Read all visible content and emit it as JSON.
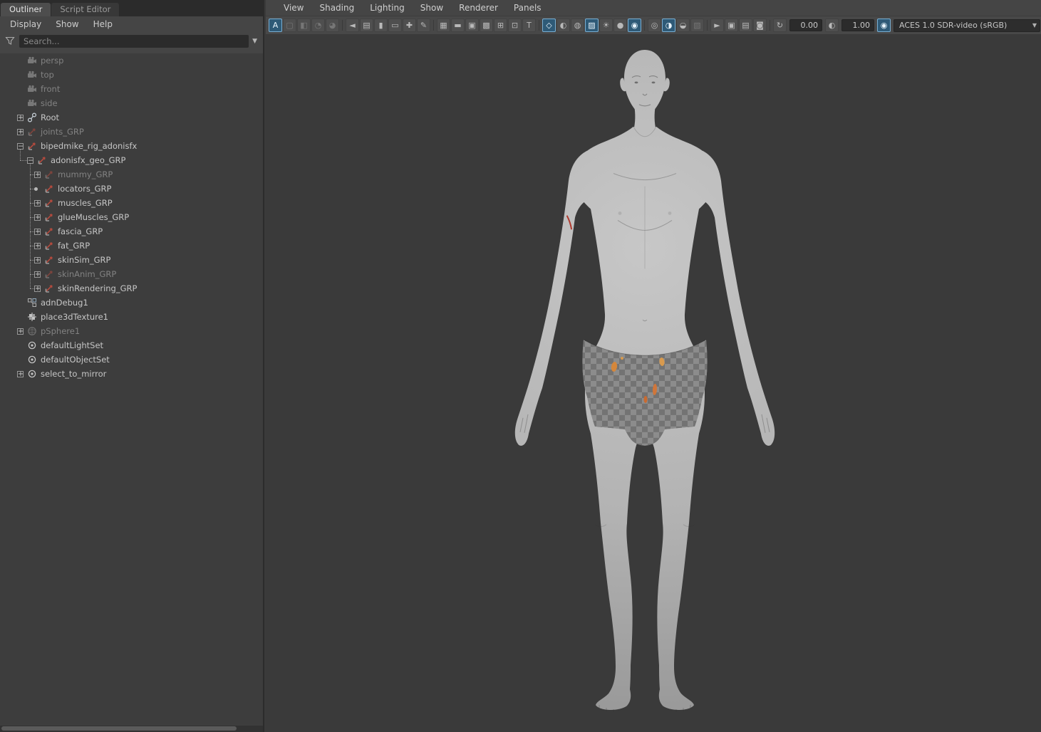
{
  "outliner": {
    "tabs": [
      {
        "label": "Outliner",
        "active": true
      },
      {
        "label": "Script Editor",
        "active": false
      }
    ],
    "menus": [
      {
        "label": "Display"
      },
      {
        "label": "Show"
      },
      {
        "label": "Help"
      }
    ],
    "search": {
      "placeholder": "Search..."
    },
    "tree": [
      {
        "label": "persp",
        "icon": "camera-icon",
        "dim": true,
        "indent": 1
      },
      {
        "label": "top",
        "icon": "camera-icon",
        "dim": true,
        "indent": 1
      },
      {
        "label": "front",
        "icon": "camera-icon",
        "dim": true,
        "indent": 1
      },
      {
        "label": "side",
        "icon": "camera-icon",
        "dim": true,
        "indent": 1
      },
      {
        "label": "Root",
        "icon": "joint-icon",
        "indent": 1,
        "expander": "plus"
      },
      {
        "label": "joints_GRP",
        "icon": "transform-icon",
        "dim": true,
        "indent": 1,
        "expander": "plus"
      },
      {
        "label": "bipedmike_rig_adonisfx",
        "icon": "transform-icon",
        "indent": 1,
        "expander": "minus"
      },
      {
        "label": "adonisfx_geo_GRP",
        "icon": "transform-icon",
        "indent": 2,
        "expander": "minus",
        "dash": true
      },
      {
        "label": "mummy_GRP",
        "icon": "transform-icon",
        "dim": true,
        "indent": 3,
        "expander": "plus",
        "dash": true
      },
      {
        "label": "locators_GRP",
        "icon": "transform-icon",
        "indent": 3,
        "expander": "dot",
        "dash": true
      },
      {
        "label": "muscles_GRP",
        "icon": "transform-icon",
        "indent": 3,
        "expander": "plus",
        "dash": true
      },
      {
        "label": "glueMuscles_GRP",
        "icon": "transform-icon",
        "indent": 3,
        "expander": "plus",
        "dash": true
      },
      {
        "label": "fascia_GRP",
        "icon": "transform-icon",
        "indent": 3,
        "expander": "plus",
        "dash": true
      },
      {
        "label": "fat_GRP",
        "icon": "transform-icon",
        "indent": 3,
        "expander": "plus",
        "dash": true
      },
      {
        "label": "skinSim_GRP",
        "icon": "transform-icon",
        "indent": 3,
        "expander": "plus",
        "dash": true
      },
      {
        "label": "skinAnim_GRP",
        "icon": "transform-icon",
        "dim": true,
        "indent": 3,
        "expander": "plus",
        "dash": true
      },
      {
        "label": "skinRendering_GRP",
        "icon": "transform-icon",
        "indent": 3,
        "expander": "plus",
        "dash": true
      },
      {
        "label": "adnDebug1",
        "icon": "adn-debug-icon",
        "indent": 1
      },
      {
        "label": "place3dTexture1",
        "icon": "place3d-texture-icon",
        "indent": 1
      },
      {
        "label": "pSphere1",
        "icon": "mesh-icon",
        "dim": true,
        "indent": 1,
        "expander": "plus"
      },
      {
        "label": "defaultLightSet",
        "icon": "set-icon",
        "indent": 1
      },
      {
        "label": "defaultObjectSet",
        "icon": "set-icon",
        "indent": 1
      },
      {
        "label": "select_to_mirror",
        "icon": "set-icon",
        "indent": 1,
        "expander": "plus"
      }
    ]
  },
  "viewport": {
    "menus": [
      {
        "label": "View"
      },
      {
        "label": "Shading"
      },
      {
        "label": "Lighting"
      },
      {
        "label": "Show"
      },
      {
        "label": "Renderer"
      },
      {
        "label": "Panels"
      }
    ],
    "toolbar": [
      {
        "name": "panel-focus-a-icon",
        "active": true
      },
      {
        "name": "wireframe-on-shaded-icon",
        "dim": true
      },
      {
        "name": "default-material-icon",
        "dim": true
      },
      {
        "name": "hardware-texture-icon",
        "dim": true
      },
      {
        "name": "hardware-light-icon",
        "dim": true
      },
      {
        "sep": true
      },
      {
        "name": "select-camera-icon"
      },
      {
        "name": "camera-attributes-icon"
      },
      {
        "name": "bookmark-icon"
      },
      {
        "name": "image-plane-icon"
      },
      {
        "name": "two-d-pan-zoom-icon"
      },
      {
        "name": "grease-pencil-icon"
      },
      {
        "sep": true
      },
      {
        "name": "grid-icon"
      },
      {
        "name": "film-gate-icon"
      },
      {
        "name": "resolution-gate-icon"
      },
      {
        "name": "gate-mask-icon"
      },
      {
        "name": "field-chart-icon"
      },
      {
        "name": "safe-action-icon"
      },
      {
        "name": "safe-title-icon"
      },
      {
        "sep": true
      },
      {
        "name": "shaded-cube-icon",
        "active": true
      },
      {
        "name": "smooth-shade-icon"
      },
      {
        "name": "wireframe-sphere-icon"
      },
      {
        "name": "textured-icon",
        "active": true
      },
      {
        "name": "use-all-lights-icon"
      },
      {
        "name": "shadows-icon"
      },
      {
        "name": "ssao-icon",
        "active": true
      },
      {
        "sep": true
      },
      {
        "name": "motion-blur-icon"
      },
      {
        "name": "multisample-icon",
        "active": true
      },
      {
        "name": "depth-of-field-icon"
      },
      {
        "name": "fog-icon",
        "dim": true
      },
      {
        "sep": true
      },
      {
        "name": "isolate-select-icon"
      },
      {
        "name": "copy-snapshot-icon"
      },
      {
        "name": "paste-snapshot-icon"
      },
      {
        "name": "snapshot-image-icon"
      },
      {
        "sep": true
      },
      {
        "name": "exposure-icon"
      },
      {
        "input": "exposure",
        "name": "exposure-field"
      },
      {
        "name": "gamma-icon"
      },
      {
        "input": "gamma",
        "name": "gamma-field"
      },
      {
        "name": "view-transform-icon",
        "active": true
      },
      {
        "select": "view_transform",
        "name": "view-transform-dropdown"
      }
    ],
    "exposure": {
      "value": "0.00"
    },
    "gamma": {
      "value": "1.00"
    },
    "view_transform": {
      "label": "ACES 1.0 SDR-video (sRGB)"
    }
  },
  "colors": {
    "accent_blue": "#79aed2",
    "panel_bg": "#454545",
    "viewport_bg": "#3a3a3a",
    "model_gray": "#b5b5b5",
    "underwear_checker_dark": "#737373",
    "underwear_checker_light": "#8e8e8e",
    "decal_orange": "#d5873b"
  }
}
